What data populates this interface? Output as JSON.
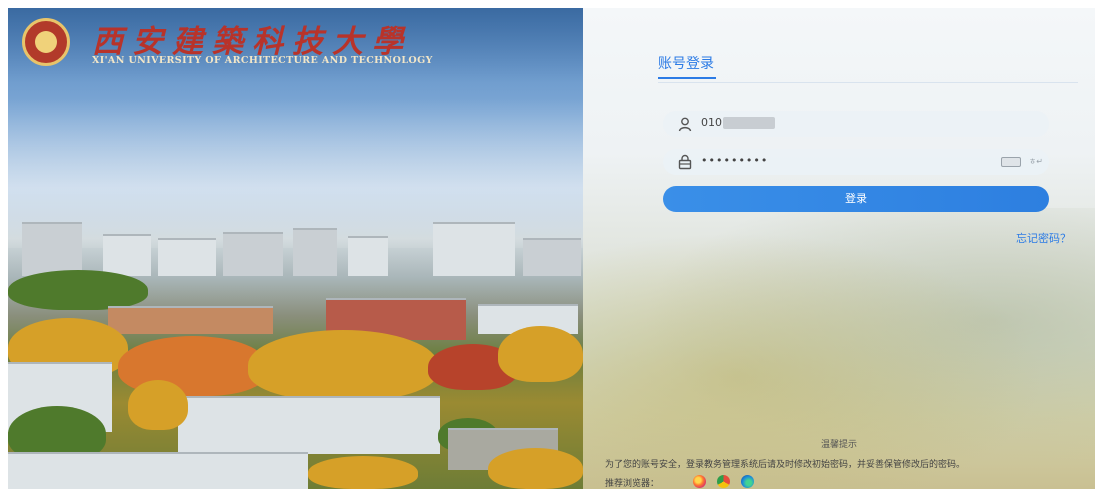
{
  "branding": {
    "logo_script": "西安建築科技大學",
    "logo_english": "XI'AN UNIVERSITY OF ARCHITECTURE AND TECHNOLOGY"
  },
  "login": {
    "tab_label": "账号登录",
    "username_value": "010",
    "password_value": "•••••••••",
    "keyboard_hint": "ㅎ↵",
    "submit_label": "登录",
    "forgot_label": "忘记密码？"
  },
  "tips": {
    "title": "温馨提示",
    "body": "为了您的账号安全，登录教务管理系统后请及时修改初始密码，并妥善保管修改后的密码。",
    "browser_label": "推荐浏览器："
  },
  "browsers": [
    "firefox-icon",
    "chrome-icon",
    "edge-icon"
  ],
  "colors": {
    "accent": "#2c7be5",
    "button": "#3a8fe8",
    "logo_red": "#b8332a"
  }
}
